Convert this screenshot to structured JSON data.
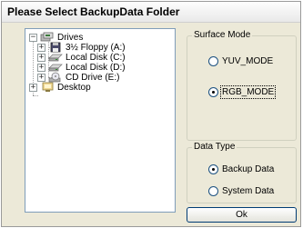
{
  "window": {
    "title": "Please Select BackupData Folder"
  },
  "tree": {
    "root": {
      "label": "Drives",
      "expander": "−",
      "icon": "drives-icon"
    },
    "drives": [
      {
        "label": "3½ Floppy (A:)",
        "expander": "+",
        "icon": "floppy-icon"
      },
      {
        "label": "Local Disk (C:)",
        "expander": "+",
        "icon": "hard-disk-icon"
      },
      {
        "label": "Local Disk (D:)",
        "expander": "+",
        "icon": "hard-disk-icon"
      },
      {
        "label": "CD Drive (E:)",
        "expander": "+",
        "icon": "cd-drive-icon"
      }
    ],
    "desktop": {
      "label": "Desktop",
      "expander": "+",
      "icon": "desktop-icon"
    }
  },
  "surface_mode": {
    "label": "Surface Mode",
    "options": [
      {
        "label": "YUV_MODE",
        "checked": false
      },
      {
        "label": "RGB_MODE",
        "checked": true
      }
    ]
  },
  "data_type": {
    "label": "Data Type",
    "options": [
      {
        "label": "Backup Data",
        "checked": true
      },
      {
        "label": "System Data",
        "checked": false
      }
    ]
  },
  "ok_button": {
    "label": "Ok"
  }
}
